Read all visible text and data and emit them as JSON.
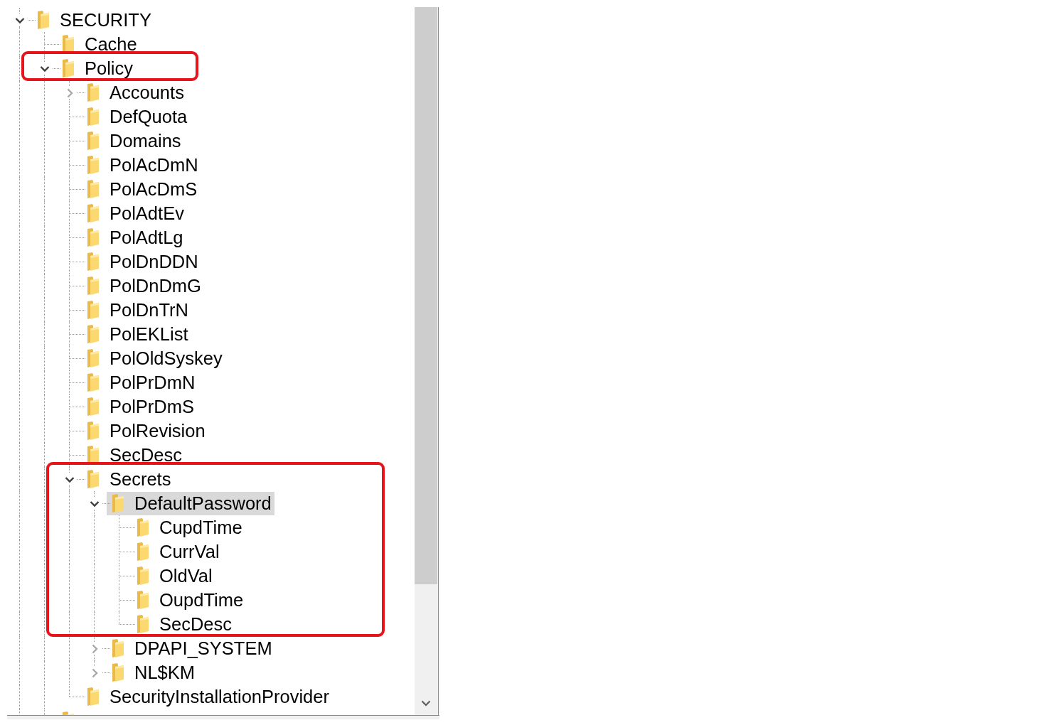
{
  "tree": [
    {
      "label": "SECURITY",
      "expanded": true,
      "selected": false,
      "annotated": false,
      "children": [
        {
          "label": "Cache",
          "selected": false,
          "annotated": false
        },
        {
          "label": "Policy",
          "expanded": true,
          "selected": false,
          "annotated": true,
          "children": [
            {
              "label": "Accounts",
              "expanded": false,
              "selected": false,
              "annotated": false
            },
            {
              "label": "DefQuota",
              "selected": false,
              "annotated": false
            },
            {
              "label": "Domains",
              "selected": false,
              "annotated": false
            },
            {
              "label": "PolAcDmN",
              "selected": false,
              "annotated": false
            },
            {
              "label": "PolAcDmS",
              "selected": false,
              "annotated": false
            },
            {
              "label": "PolAdtEv",
              "selected": false,
              "annotated": false
            },
            {
              "label": "PolAdtLg",
              "selected": false,
              "annotated": false
            },
            {
              "label": "PolDnDDN",
              "selected": false,
              "annotated": false
            },
            {
              "label": "PolDnDmG",
              "selected": false,
              "annotated": false
            },
            {
              "label": "PolDnTrN",
              "selected": false,
              "annotated": false
            },
            {
              "label": "PolEKList",
              "selected": false,
              "annotated": false
            },
            {
              "label": "PolOldSyskey",
              "selected": false,
              "annotated": false
            },
            {
              "label": "PolPrDmN",
              "selected": false,
              "annotated": false
            },
            {
              "label": "PolPrDmS",
              "selected": false,
              "annotated": false
            },
            {
              "label": "PolRevision",
              "selected": false,
              "annotated": false
            },
            {
              "label": "SecDesc",
              "selected": false,
              "annotated": false
            },
            {
              "label": "Secrets",
              "expanded": true,
              "selected": false,
              "annotated": true,
              "children": [
                {
                  "label": "DefaultPassword",
                  "expanded": true,
                  "selected": true,
                  "annotated": true,
                  "children": [
                    {
                      "label": "CupdTime",
                      "selected": false,
                      "annotated": true
                    },
                    {
                      "label": "CurrVal",
                      "selected": false,
                      "annotated": true
                    },
                    {
                      "label": "OldVal",
                      "selected": false,
                      "annotated": true
                    },
                    {
                      "label": "OupdTime",
                      "selected": false,
                      "annotated": true
                    },
                    {
                      "label": "SecDesc",
                      "selected": false,
                      "annotated": true
                    }
                  ]
                },
                {
                  "label": "DPAPI_SYSTEM",
                  "expanded": false,
                  "selected": false,
                  "annotated": false
                },
                {
                  "label": "NL$KM",
                  "expanded": false,
                  "selected": false,
                  "annotated": false
                }
              ]
            },
            {
              "label": "SecurityInstallationProvider",
              "selected": false,
              "annotated": false
            }
          ]
        },
        {
          "selected": false,
          "annotated": false
        }
      ]
    }
  ]
}
